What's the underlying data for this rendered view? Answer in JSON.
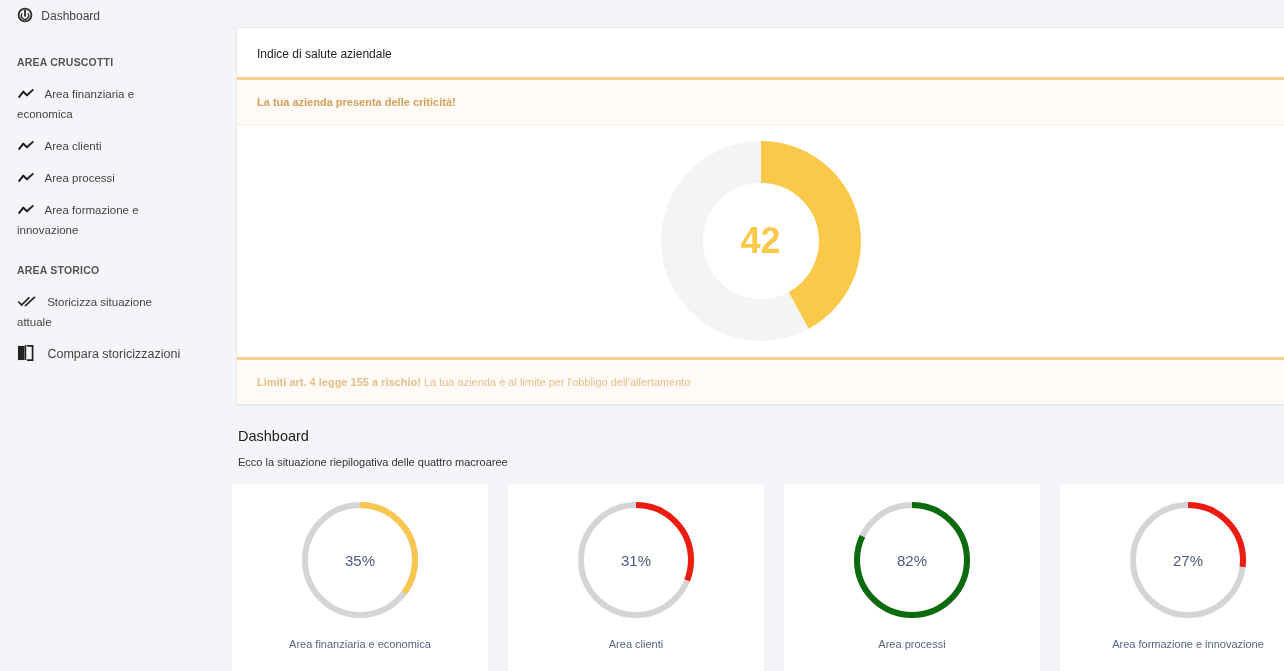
{
  "sidebar": {
    "top": {
      "label": "Dashboard"
    },
    "sections": [
      {
        "heading": "AREA CRUSCOTTI",
        "items": [
          {
            "label": "Area finanziaria e economica",
            "kind": "trend"
          },
          {
            "label": "Area clienti",
            "kind": "trend"
          },
          {
            "label": "Area processi",
            "kind": "trend"
          },
          {
            "label": "Area formazione e innovazione",
            "kind": "trend"
          }
        ]
      },
      {
        "heading": "AREA STORICO",
        "items": [
          {
            "label": "Storicizza situazione attuale",
            "kind": "history"
          },
          {
            "label": "Compara storicizzazioni",
            "kind": "compare"
          }
        ]
      }
    ]
  },
  "health": {
    "title": "Indice di salute aziendale",
    "alert": "La tua azienda presenta delle criticità!",
    "gauge": {
      "value": "42",
      "color": "#fbc94a"
    },
    "warning": "**Limiti art. 4 legge 155 a rischio!** La tua azienda è al limite per l'obbligo dell'allertamento"
  },
  "dashboard": {
    "title": "Dashboard",
    "subtitle": "Ecco la situazione riepilogativa delle quattro macroaree",
    "areas": [
      {
        "label": "Area finanziaria e economica",
        "value": "35%",
        "color": "#f9c74f"
      },
      {
        "label": "Area clienti",
        "value": "31%",
        "color": "#ee1c0e"
      },
      {
        "label": "Area processi",
        "value": "82%",
        "color": "#0a6b0a"
      },
      {
        "label": "Area formazione e innovazione",
        "value": "27%",
        "color": "#ee1c0e"
      }
    ]
  }
}
